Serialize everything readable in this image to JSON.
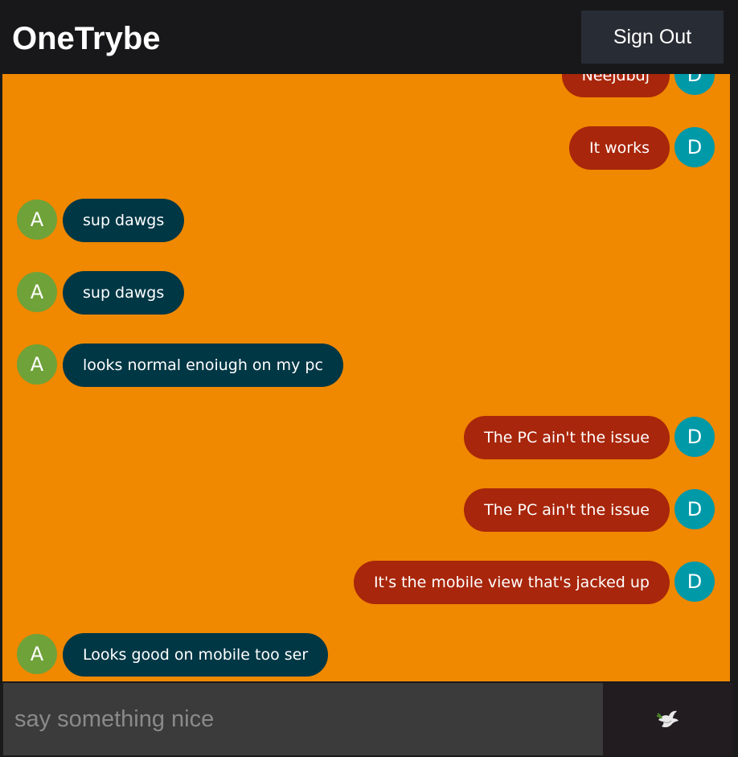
{
  "app": {
    "title": "OneTrybe",
    "sign_out_label": "Sign Out"
  },
  "colors": {
    "chat_background": "#f08800",
    "sent_bubble": "#a8260b",
    "received_bubble": "#003745",
    "avatar_d": "#0099a8",
    "avatar_a": "#6fa239"
  },
  "messages": [
    {
      "text": "Neejdbdj",
      "side": "sent",
      "avatar": "D"
    },
    {
      "text": "It works",
      "side": "sent",
      "avatar": "D"
    },
    {
      "text": "sup dawgs",
      "side": "received",
      "avatar": "A"
    },
    {
      "text": "sup dawgs",
      "side": "received",
      "avatar": "A"
    },
    {
      "text": "looks normal enoiugh on my pc",
      "side": "received",
      "avatar": "A"
    },
    {
      "text": "The PC ain't the issue",
      "side": "sent",
      "avatar": "D"
    },
    {
      "text": "The PC ain't the issue",
      "side": "sent",
      "avatar": "D"
    },
    {
      "text": "It's the mobile view that's jacked up",
      "side": "sent",
      "avatar": "D"
    },
    {
      "text": "Looks good on mobile too ser",
      "side": "received",
      "avatar": "A"
    }
  ],
  "composer": {
    "placeholder": "say something nice",
    "value": "",
    "send_icon": "dove-icon"
  }
}
